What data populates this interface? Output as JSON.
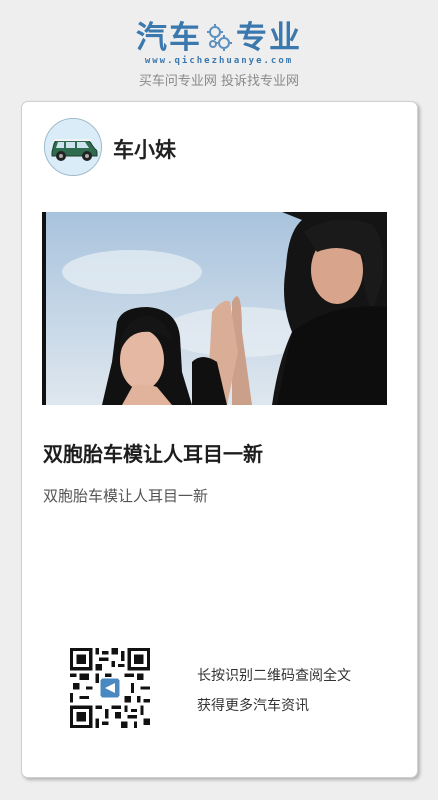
{
  "header": {
    "logo_left": "汽车",
    "logo_right": "专业",
    "domain": "www.qichezhuanye.com",
    "slogan": "买车问专业网 投诉找专业网"
  },
  "card": {
    "author": "车小妹",
    "article_title": "双胞胎车模让人耳目一新",
    "article_summary": "双胞胎车模让人耳目一新",
    "qr_line1": "长按识别二维码查阅全文",
    "qr_line2": "获得更多汽车资讯"
  },
  "colors": {
    "brand_blue": "#3a78ad",
    "card_background": "#ffffff",
    "page_background": "#eeeeee"
  },
  "icons": {
    "logo_gear": "gear-icon",
    "avatar": "car-icon"
  }
}
